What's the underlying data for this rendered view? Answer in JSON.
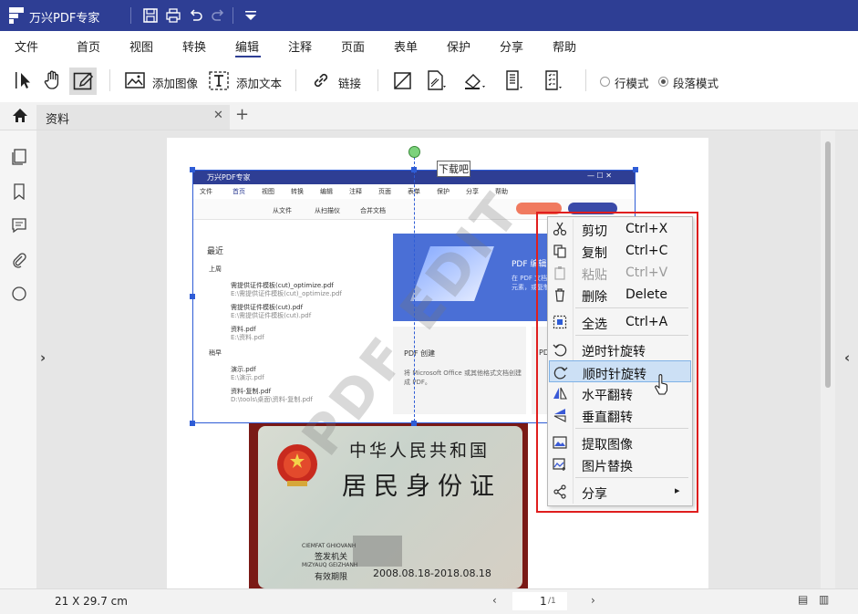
{
  "app": {
    "title": "万兴PDF专家"
  },
  "menu": {
    "items": [
      "文件",
      "首页",
      "视图",
      "转换",
      "编辑",
      "注释",
      "页面",
      "表单",
      "保护",
      "分享",
      "帮助"
    ],
    "active_index": 4
  },
  "toolbar": {
    "add_image": "添加图像",
    "add_text": "添加文本",
    "link": "链接",
    "line_mode": "行模式",
    "paragraph_mode": "段落模式"
  },
  "tab": {
    "name": "资料"
  },
  "status": {
    "page_size": "21 X 29.7 cm",
    "page_current": "1",
    "page_total": "/1"
  },
  "annotation": {
    "label": "下载吧"
  },
  "embedded": {
    "title": "万兴PDF专家",
    "menu": [
      "文件",
      "首页",
      "视图",
      "转换",
      "编辑",
      "注释",
      "页面",
      "表单",
      "保护",
      "分享",
      "帮助"
    ],
    "toolbar": [
      "从文件",
      "从扫描仪",
      "合并文档"
    ],
    "recent_title": "最近",
    "group_lastweek": "上周",
    "group_earlier": "稍早",
    "files": [
      {
        "name": "需提供证件模板(cut)_optimize.pdf",
        "path": "E:\\需提供证件模板(cut)_optimize.pdf"
      },
      {
        "name": "需提供证件模板(cut).pdf",
        "path": "E:\\需提供证件模板(cut).pdf"
      },
      {
        "name": "资料.pdf",
        "path": "E:\\资料.pdf"
      },
      {
        "name": "演示.pdf",
        "path": "E:\\演示.pdf"
      },
      {
        "name": "资料-复制.pdf",
        "path": "D:\\tools\\桌面\\资料-复制.pdf"
      }
    ],
    "card_title": "PDF 编辑",
    "card_text": "在 PDF 文档中，轻松编辑文本、图像等元素，或复制、粘贴。",
    "create_title": "PDF 创建",
    "create_text": "将 Microsoft Office 或其他格式文档创建成 PDF。",
    "create_title2": "PD"
  },
  "id_card": {
    "line1": "中华人民共和国",
    "line2": "居民身份证",
    "issuer_label": "签发机关",
    "validity_label": "有效期限",
    "validity": "2008.08.18-2018.08.18",
    "pinyin1": "CIEMFAT GHIOVANH",
    "pinyin2": "MIZYAUQ GEIZHANH"
  },
  "watermark": "PDF EDIT",
  "context_menu": {
    "items": [
      {
        "icon": "scissors-icon",
        "label": "剪切",
        "shortcut": "Ctrl+X",
        "enabled": true
      },
      {
        "icon": "copy-icon",
        "label": "复制",
        "shortcut": "Ctrl+C",
        "enabled": true
      },
      {
        "icon": "paste-icon",
        "label": "粘贴",
        "shortcut": "Ctrl+V",
        "enabled": false
      },
      {
        "icon": "trash-icon",
        "label": "删除",
        "shortcut": "Delete",
        "enabled": true
      },
      {
        "icon": "select-all-icon",
        "label": "全选",
        "shortcut": "Ctrl+A",
        "enabled": true
      },
      {
        "icon": "rotate-ccw-icon",
        "label": "逆时针旋转",
        "shortcut": "",
        "enabled": true
      },
      {
        "icon": "rotate-cw-icon",
        "label": "顺时针旋转",
        "shortcut": "",
        "enabled": true
      },
      {
        "icon": "flip-horizontal-icon",
        "label": "水平翻转",
        "shortcut": "",
        "enabled": true
      },
      {
        "icon": "flip-vertical-icon",
        "label": "垂直翻转",
        "shortcut": "",
        "enabled": true
      },
      {
        "icon": "extract-image-icon",
        "label": "提取图像",
        "shortcut": "",
        "enabled": true
      },
      {
        "icon": "replace-image-icon",
        "label": "图片替换",
        "shortcut": "",
        "enabled": true
      },
      {
        "icon": "share-icon",
        "label": "分享",
        "shortcut": "",
        "enabled": true
      }
    ],
    "highlighted_index": 6
  }
}
